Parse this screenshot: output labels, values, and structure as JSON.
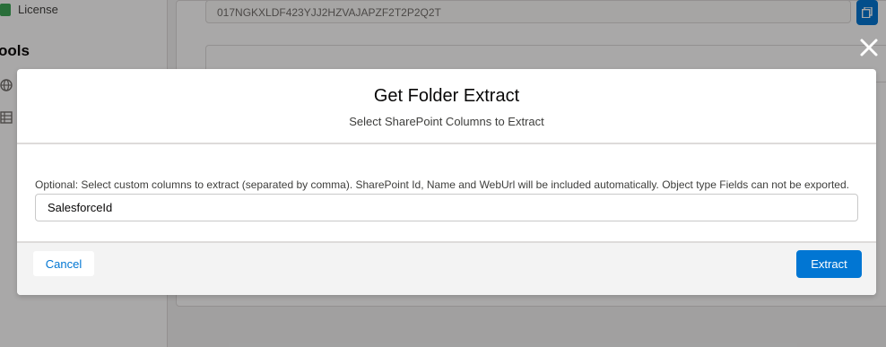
{
  "background": {
    "sidebar": {
      "license_label": "License",
      "tools_heading": "ools"
    },
    "license_key": "017NGKXLDF423YJJ2HZVAJAPZF2T2P2Q2T"
  },
  "modal": {
    "title": "Get Folder Extract",
    "subtitle": "Select SharePoint Columns to Extract",
    "help_text": "Optional: Select custom columns to extract (separated by comma). SharePoint Id, Name and WebUrl will be included automatically. Object type Fields can not be exported.",
    "columns_input_value": "SalesforceId",
    "cancel_label": "Cancel",
    "extract_label": "Extract"
  },
  "icons": {
    "close": "close-icon",
    "copy": "copy-icon",
    "license": "license-icon",
    "globe": "globe-icon",
    "table": "table-icon"
  },
  "colors": {
    "brand": "#0176d3",
    "license_icon": "#3ba755"
  }
}
